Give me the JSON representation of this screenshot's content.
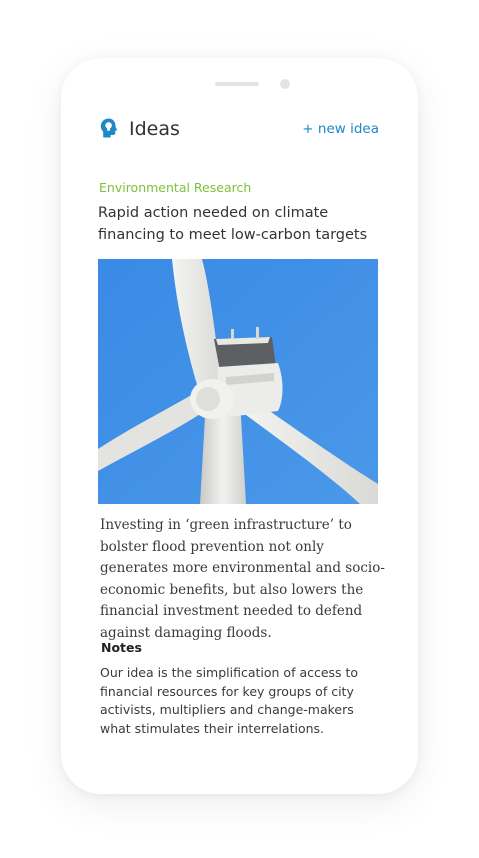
{
  "header": {
    "title": "Ideas",
    "new_idea_label": "+ new idea",
    "logo_icon": "head-lightbulb-icon"
  },
  "article": {
    "category": "Environmental Research",
    "headline": "Rapid action needed on climate financing to meet low-carbon targets",
    "image": "wind-turbine-photo",
    "body": "Investing in ‘green infrastructure’ to bolster flood prevention not only generates more environmental and socio-economic benefits, but also lowers the financial investment needed to defend against damaging floods."
  },
  "notes": {
    "title": "Notes",
    "text": "Our idea is the simplification of access to financial resources for key groups of city activists, multipliers and change-makers what stimulates their interrelations."
  },
  "colors": {
    "accent": "#1e88c8",
    "category": "#7cc23a",
    "sky": "#3d8ee5",
    "text": "#333333"
  }
}
